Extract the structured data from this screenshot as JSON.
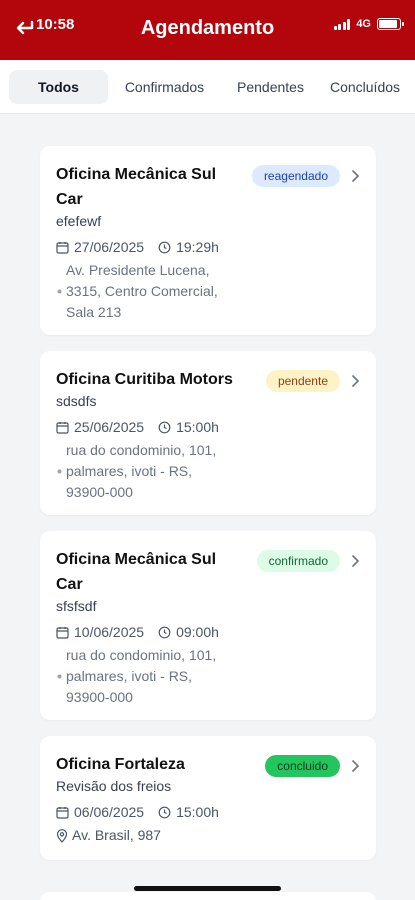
{
  "status_bar": {
    "time": "10:58",
    "network": "4G"
  },
  "header": {
    "title": "Agendamento"
  },
  "tabs": [
    {
      "label": "Todos"
    },
    {
      "label": "Confirmados"
    },
    {
      "label": "Pendentes"
    },
    {
      "label": "Concluídos"
    }
  ],
  "appointments": [
    {
      "name": "Oficina Mecânica Sul Car",
      "status": "reagendado",
      "description": "efefewf",
      "date": "27/06/2025",
      "time": "19:29h",
      "address": "Av. Presidente Lucena, 3315, Centro Comercial, Sala 213"
    },
    {
      "name": "Oficina Curitiba Motors",
      "status": "pendente",
      "description": "sdsdfs",
      "date": "25/06/2025",
      "time": "15:00h",
      "address": "rua do condominio, 101, palmares, ivoti - RS, 93900-000"
    },
    {
      "name": "Oficina Mecânica Sul Car",
      "status": "confirmado",
      "description": "sfsfsdf",
      "date": "10/06/2025",
      "time": "09:00h",
      "address": "rua do condominio, 101, palmares, ivoti - RS, 93900-000"
    },
    {
      "name": "Oficina Fortaleza",
      "status": "concluido",
      "description": "Revisão dos freios",
      "date": "06/06/2025",
      "time": "15:00h",
      "address": "Av. Brasil, 987"
    }
  ],
  "colors": {
    "header_bg": "#b3060c",
    "reagendado_bg": "#dbeafe",
    "pendente_bg": "#fef3c7",
    "confirmado_bg": "#dcfce7",
    "concluido_bg": "#22c55e"
  },
  "icons": [
    "back-arrow-icon",
    "signal-icon",
    "battery-icon",
    "calendar-icon",
    "clock-icon",
    "chevron-right-icon",
    "location-pin-icon"
  ]
}
